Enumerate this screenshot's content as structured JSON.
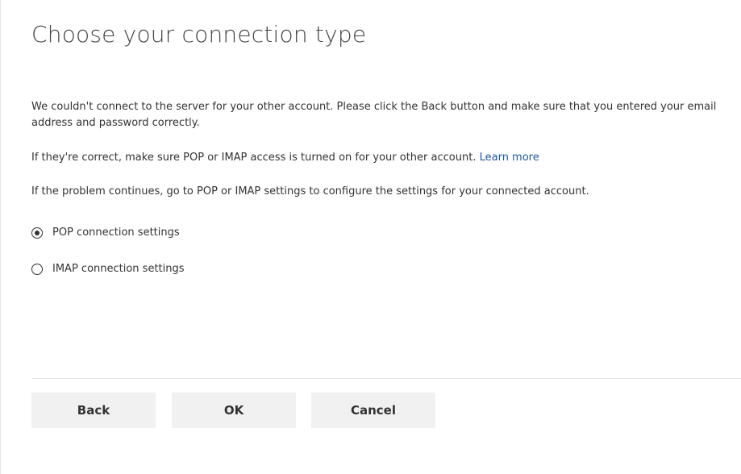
{
  "dialog": {
    "title": "Choose your connection type",
    "message_1": "We couldn't connect to the server for your other account. Please click the Back button and make sure that you entered your email address and password correctly.",
    "message_2": "If they're correct, make sure POP or IMAP access is turned on for your other account.",
    "learn_more": "Learn more",
    "message_3": "If the problem continues, go to POP or IMAP settings to configure the settings for your connected account."
  },
  "options": [
    {
      "label": "POP connection settings",
      "selected": true
    },
    {
      "label": "IMAP connection settings",
      "selected": false
    }
  ],
  "buttons": {
    "back": "Back",
    "ok": "OK",
    "cancel": "Cancel"
  }
}
